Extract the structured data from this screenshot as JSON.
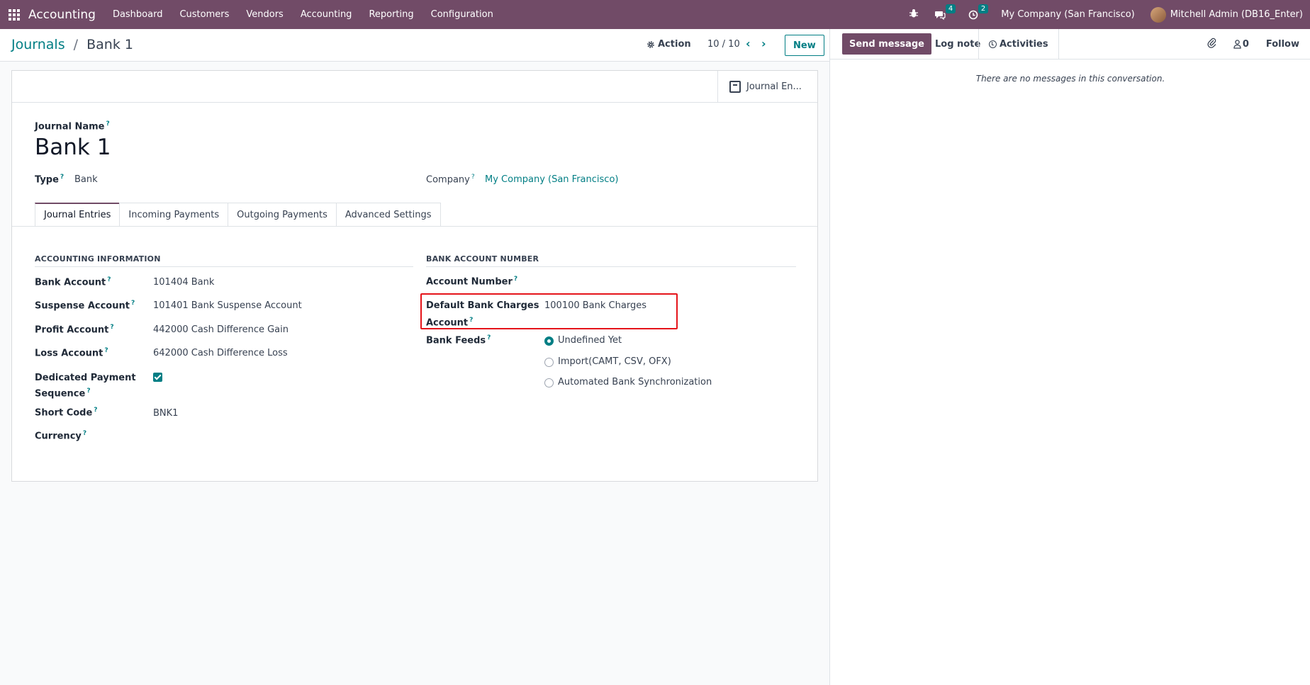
{
  "navbar": {
    "brand": "Accounting",
    "menu": [
      "Dashboard",
      "Customers",
      "Vendors",
      "Accounting",
      "Reporting",
      "Configuration"
    ],
    "messages_badge": "4",
    "activities_badge": "2",
    "company": "My Company (San Francisco)",
    "user": "Mitchell Admin (DB16_Enter)"
  },
  "control": {
    "breadcrumb_parent": "Journals",
    "breadcrumb_sep": "/",
    "breadcrumb_current": "Bank 1",
    "action_label": "Action",
    "pager": "10 / 10",
    "new_label": "New"
  },
  "form": {
    "smart_button": "Journal En...",
    "journal_name_label": "Journal Name",
    "journal_name": "Bank 1",
    "type_label": "Type",
    "type_value": "Bank",
    "company_label": "Company",
    "company_value": "My Company (San Francisco)",
    "tabs": [
      "Journal Entries",
      "Incoming Payments",
      "Outgoing Payments",
      "Advanced Settings"
    ],
    "accounting": {
      "title": "ACCOUNTING INFORMATION",
      "bank_account_label": "Bank Account",
      "bank_account": "101404 Bank",
      "suspense_label": "Suspense Account",
      "suspense": "101401 Bank Suspense Account",
      "profit_label": "Profit Account",
      "profit": "442000 Cash Difference Gain",
      "loss_label": "Loss Account",
      "loss": "642000 Cash Difference Loss",
      "dedicated_label_1": "Dedicated Payment",
      "dedicated_label_2": "Sequence",
      "dedicated_checked": true,
      "short_code_label": "Short Code",
      "short_code": "BNK1",
      "currency_label": "Currency",
      "currency": ""
    },
    "bank": {
      "title": "BANK ACCOUNT NUMBER",
      "account_number_label": "Account Number",
      "account_number": "",
      "charges_label_1": "Default Bank Charges",
      "charges_label_2": "Account",
      "charges_value": "100100 Bank Charges",
      "feeds_label": "Bank Feeds",
      "feeds_options": [
        "Undefined Yet",
        "Import(CAMT, CSV, OFX)",
        "Automated Bank Synchronization"
      ],
      "feeds_selected": "Undefined Yet"
    }
  },
  "chatter": {
    "send_message": "Send message",
    "log_note": "Log note",
    "activities": "Activities",
    "followers_count": "0",
    "follow": "Follow",
    "empty": "There are no messages in this conversation."
  },
  "colors": {
    "brand": "#714b67",
    "accent": "#017e84",
    "highlight": "#e5141a"
  }
}
